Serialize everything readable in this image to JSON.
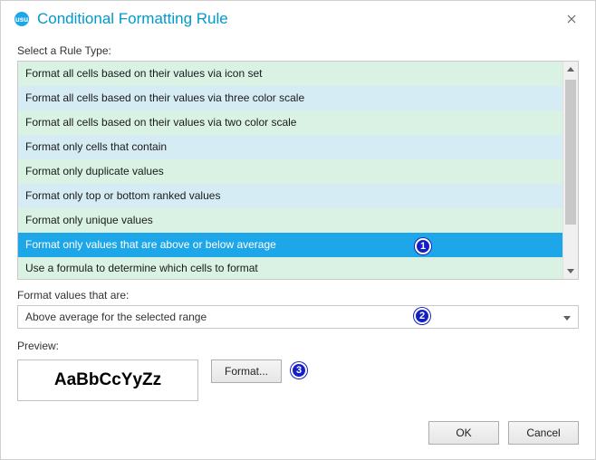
{
  "dialog": {
    "title": "Conditional Formatting Rule",
    "select_rule_label": "Select a Rule Type:",
    "format_values_label": "Format values that are:",
    "preview_label": "Preview:"
  },
  "rule_types": [
    "Format all cells based on their values via icon set",
    "Format all cells based on their values via three color scale",
    "Format all cells based on their values via two color scale",
    "Format only cells that contain",
    "Format only duplicate values",
    "Format only top or bottom ranked values",
    "Format only unique values",
    "Format only values that are above or below average",
    "Use a formula to determine which cells to format"
  ],
  "selected_rule_index": 7,
  "combo": {
    "value": "Above average for the selected range"
  },
  "preview": {
    "sample": "AaBbCcYyZz"
  },
  "buttons": {
    "format": "Format...",
    "ok": "OK",
    "cancel": "Cancel"
  },
  "callouts": {
    "1": "1",
    "2": "2",
    "3": "3"
  }
}
